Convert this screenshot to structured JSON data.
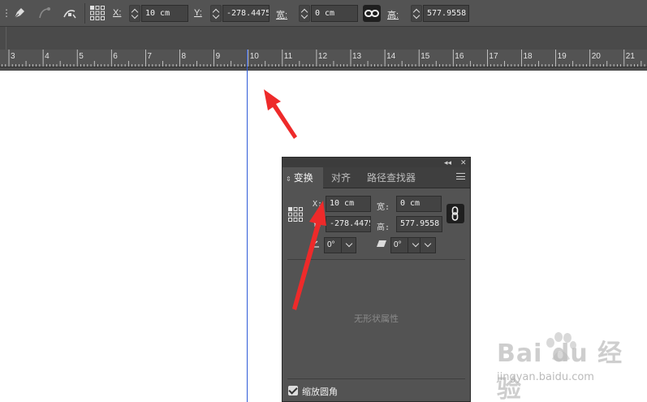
{
  "control_bar": {
    "x_label": "X:",
    "x_value": "10 cm",
    "y_label": "Y:",
    "y_value": "-278.4475",
    "w_label": "宽:",
    "w_value": "0 cm",
    "h_label": "高:",
    "h_value": "577.9558"
  },
  "ruler": {
    "labels": [
      "3",
      "4",
      "5",
      "6",
      "7",
      "8",
      "9",
      "10",
      "11",
      "12",
      "13",
      "14",
      "15",
      "16",
      "17",
      "18",
      "19",
      "20",
      "21"
    ]
  },
  "panel": {
    "tabs": [
      {
        "label": "变换",
        "active": true
      },
      {
        "label": "对齐",
        "active": false
      },
      {
        "label": "路径查找器",
        "active": false
      }
    ],
    "collapse_glyph": "◂◂",
    "close_glyph": "✕",
    "x_label": "X:",
    "x_value": "10 cm",
    "y_label": "Y:",
    "y_value": "-278.4475",
    "w_label": "宽:",
    "w_value": "0 cm",
    "h_label": "高:",
    "h_value": "577.9558",
    "rotate_value": "0°",
    "shear_value": "0°",
    "empty_message": "无形状属性",
    "scale_corners_label": "缩放圆角",
    "scale_corners_checked": true
  },
  "watermark": {
    "brand": "Bai du 经验",
    "url": "jingyan.baidu.com"
  },
  "colors": {
    "chrome": "#535353",
    "guide": "#2f5bd8",
    "annotation": "#ee2a2a"
  }
}
